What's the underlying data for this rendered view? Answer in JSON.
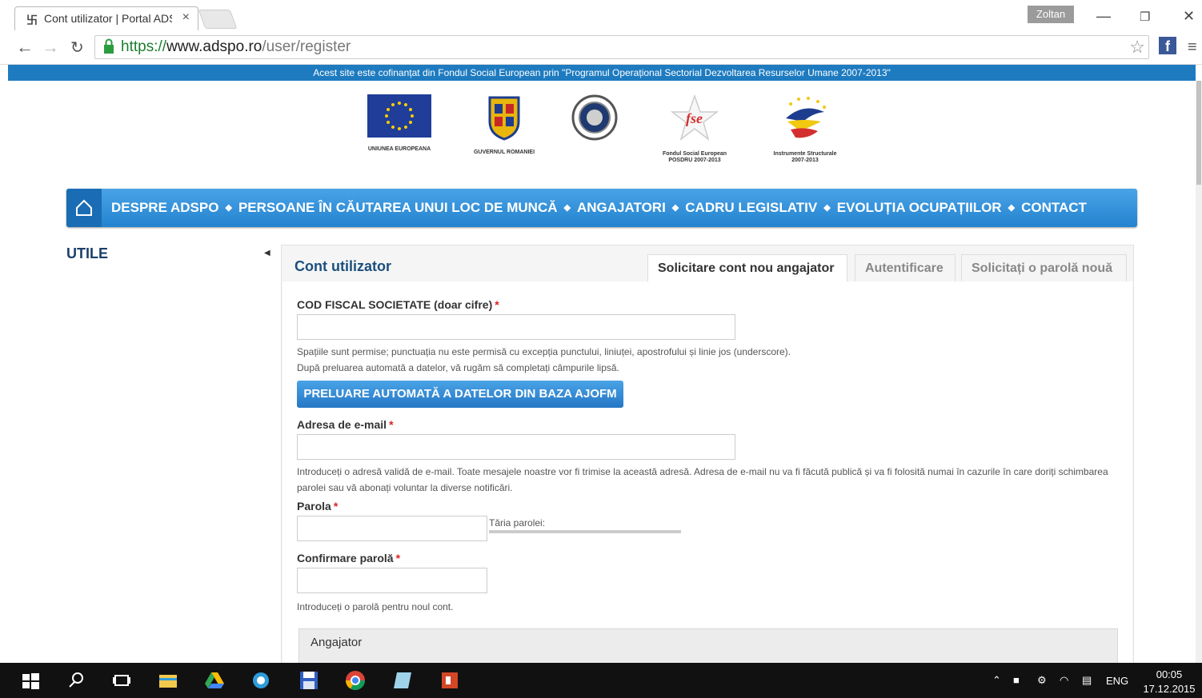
{
  "browser": {
    "tab_title": "Cont utilizator | Portal ADS",
    "user": "Zoltan",
    "url_scheme": "https://",
    "url_host": "www.adspo.ro",
    "url_path": "/user/register"
  },
  "banner": {
    "text": "Acest site este cofinanțat din Fondul Social European prin \"Programul Operațional Sectorial Dezvoltarea Resurselor Umane 2007-2013\""
  },
  "logos": {
    "eu": "UNIUNEA EUROPEANA",
    "gov": "GUVERNUL ROMANIEI",
    "fse_line1": "Fondul Social European",
    "fse_line2": "POSDRU 2007-2013",
    "is_line1": "Instrumente Structurale",
    "is_line2": "2007-2013",
    "fse_mark": "fse"
  },
  "nav": {
    "items": [
      "DESPRE ADSPO",
      "PERSOANE ÎN CĂUTAREA UNUI LOC DE MUNCĂ",
      "ANGAJATORI",
      "CADRU LEGISLATIV",
      "EVOLUȚIA OCUPAȚIILOR",
      "CONTACT"
    ]
  },
  "sidebar": {
    "title": "UTILE"
  },
  "panel": {
    "title": "Cont utilizator",
    "tabs": [
      "Solicitare cont nou angajator",
      "Autentificare",
      "Solicitați o parolă nouă"
    ]
  },
  "form": {
    "cod_fiscal_label": "COD FISCAL SOCIETATE (doar cifre)",
    "cod_fiscal_value": "",
    "cod_fiscal_help1": "Spațiile sunt permise; punctuația nu este permisă cu excepția punctului, liniuței, apostrofului și linie jos (underscore).",
    "cod_fiscal_help2": "După preluarea automată a datelor, vă rugăm să completați câmpurile lipsă.",
    "fetch_button": "PRELUARE AUTOMATĂ A DATELOR DIN BAZA AJOFM",
    "email_label": "Adresa de e-mail",
    "email_value": "",
    "email_help": "Introduceți o adresă validă de e-mail. Toate mesajele noastre vor fi trimise la această adresă. Adresa de e-mail nu va fi făcută publică și va fi folosită numai în cazurile în care doriți schimbarea parolei sau vă abonați voluntar la diverse notificări.",
    "password_label": "Parola",
    "password_value": "",
    "strength_label": "Tăria parolei:",
    "confirm_label": "Confirmare parolă",
    "confirm_value": "",
    "confirm_help": "Introduceți o parolă pentru noul cont.",
    "required_mark": "*",
    "fieldset_legend": "Angajator"
  },
  "taskbar": {
    "lang": "ENG",
    "time": "00:05",
    "date": "17.12.2015"
  },
  "colors": {
    "brand_blue": "#1e7bc0",
    "nav_blue": "#2383cf",
    "heading_blue": "#1b4f7e"
  }
}
